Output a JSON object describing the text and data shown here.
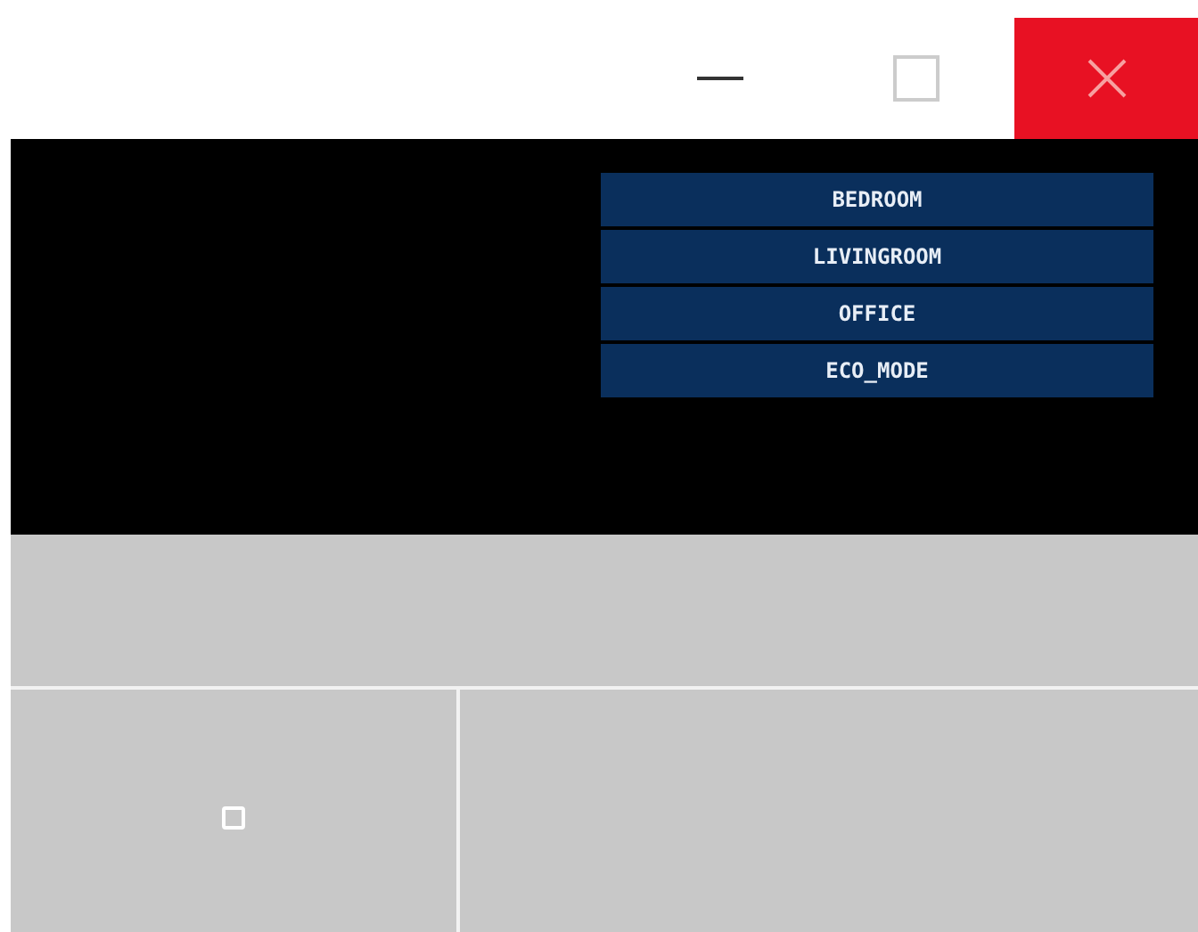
{
  "menu": [
    {
      "label": "BEDROOM"
    },
    {
      "label": "LIVINGROOM"
    },
    {
      "label": "OFFICE"
    },
    {
      "label": "ECO_MODE"
    }
  ]
}
